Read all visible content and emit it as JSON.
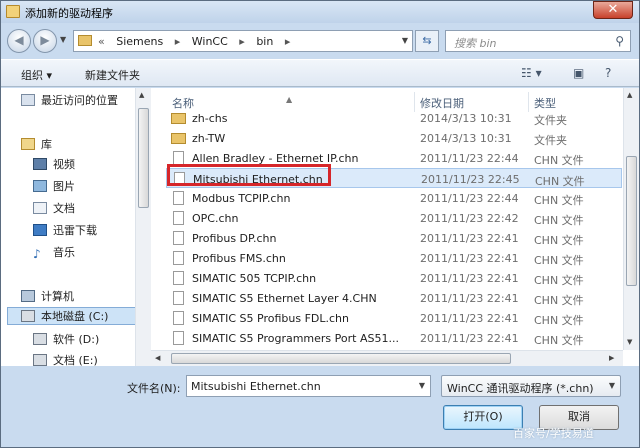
{
  "window": {
    "title": "添加新的驱动程序",
    "close_label": "✕"
  },
  "address_bar": {
    "crumbs": [
      "Siemens",
      "WinCC",
      "bin"
    ],
    "separator": "▸",
    "chevrons": "«"
  },
  "search": {
    "placeholder": "搜索 bin"
  },
  "toolbar": {
    "organize": "组织",
    "new_folder": "新建文件夹"
  },
  "nav_pane": {
    "items": [
      {
        "label": "最近访问的位置",
        "icon": "recent-places-icon"
      },
      {
        "label": "库",
        "icon": "library-icon"
      },
      {
        "label": "视频",
        "icon": "video-icon"
      },
      {
        "label": "图片",
        "icon": "picture-icon"
      },
      {
        "label": "文档",
        "icon": "document-icon"
      },
      {
        "label": "迅雷下载",
        "icon": "download-icon"
      },
      {
        "label": "音乐",
        "icon": "music-icon"
      },
      {
        "label": "计算机",
        "icon": "computer-icon"
      },
      {
        "label": "本地磁盘 (C:)",
        "icon": "drive-icon"
      },
      {
        "label": "软件 (D:)",
        "icon": "drive-icon"
      },
      {
        "label": "文档 (E:)",
        "icon": "drive-icon"
      }
    ]
  },
  "columns": {
    "name": "名称",
    "date": "修改日期",
    "type": "类型"
  },
  "files": [
    {
      "name": "zh-chs",
      "date": "2014/3/13 10:31",
      "type": "文件夹",
      "kind": "folder"
    },
    {
      "name": "zh-TW",
      "date": "2014/3/13 10:31",
      "type": "文件夹",
      "kind": "folder"
    },
    {
      "name": "Allen Bradley - Ethernet IP.chn",
      "date": "2011/11/23 22:44",
      "type": "CHN 文件",
      "kind": "file"
    },
    {
      "name": "Mitsubishi Ethernet.chn",
      "date": "2011/11/23 22:45",
      "type": "CHN 文件",
      "kind": "file",
      "selected": true
    },
    {
      "name": "Modbus TCPIP.chn",
      "date": "2011/11/23 22:44",
      "type": "CHN 文件",
      "kind": "file"
    },
    {
      "name": "OPC.chn",
      "date": "2011/11/23 22:42",
      "type": "CHN 文件",
      "kind": "file"
    },
    {
      "name": "Profibus DP.chn",
      "date": "2011/11/23 22:41",
      "type": "CHN 文件",
      "kind": "file"
    },
    {
      "name": "Profibus FMS.chn",
      "date": "2011/11/23 22:41",
      "type": "CHN 文件",
      "kind": "file"
    },
    {
      "name": "SIMATIC 505 TCPIP.chn",
      "date": "2011/11/23 22:41",
      "type": "CHN 文件",
      "kind": "file"
    },
    {
      "name": "SIMATIC S5 Ethernet Layer 4.CHN",
      "date": "2011/11/23 22:41",
      "type": "CHN 文件",
      "kind": "file"
    },
    {
      "name": "SIMATIC S5 Profibus FDL.chn",
      "date": "2011/11/23 22:41",
      "type": "CHN 文件",
      "kind": "file"
    },
    {
      "name": "SIMATIC S5 Programmers Port AS51...",
      "date": "2011/11/23 22:41",
      "type": "CHN 文件",
      "kind": "file"
    }
  ],
  "filename": {
    "label": "文件名(N):",
    "value": "Mitsubishi Ethernet.chn"
  },
  "filter": {
    "value": "WinCC 通讯驱动程序 (*.chn)"
  },
  "buttons": {
    "open": "打开(O)",
    "cancel": "取消"
  },
  "watermark": "百家号/学技易道",
  "colors": {
    "selection_outline": "#d6262a",
    "selected_row": "#dbeafa",
    "window_frame": "#c9dbef"
  }
}
